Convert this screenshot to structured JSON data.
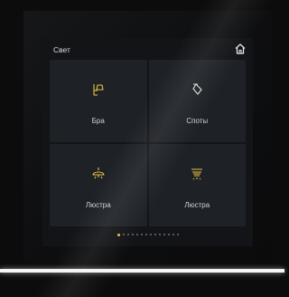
{
  "screen": {
    "title": "Свет"
  },
  "tiles": [
    {
      "label": "Бра",
      "icon": "sconce-icon",
      "icon_color": "#e8c242"
    },
    {
      "label": "Споты",
      "icon": "spotlight-icon",
      "icon_color": "#e0e0e0"
    },
    {
      "label": "Люстра",
      "icon": "chandelier-icon",
      "icon_color": "#e8c242"
    },
    {
      "label": "Люстра",
      "icon": "ceiling-light-icon",
      "icon_color": "#e8c242"
    }
  ],
  "pager": {
    "page_count": 14,
    "active_page": 1
  },
  "colors": {
    "accent": "#e8c242",
    "tile_bg": "#1e2126",
    "screen_bg": "#121417"
  }
}
